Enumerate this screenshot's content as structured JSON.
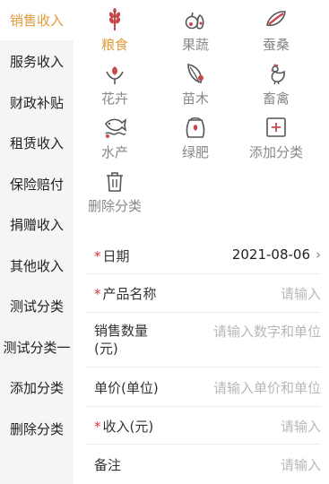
{
  "sidebar": {
    "items": [
      {
        "label": "销售收入",
        "active": true
      },
      {
        "label": "服务收入"
      },
      {
        "label": "财政补贴"
      },
      {
        "label": "租赁收入"
      },
      {
        "label": "保险赔付"
      },
      {
        "label": "捐赠收入"
      },
      {
        "label": "其他收入"
      },
      {
        "label": "测试分类"
      },
      {
        "label": "测试分类一"
      },
      {
        "label": "添加分类"
      },
      {
        "label": "删除分类"
      }
    ]
  },
  "categories": [
    {
      "label": "粮食",
      "icon": "wheat-icon",
      "selected": true
    },
    {
      "label": "果蔬",
      "icon": "fruit-vegetable-icon"
    },
    {
      "label": "蚕桑",
      "icon": "silkworm-icon"
    },
    {
      "label": "花卉",
      "icon": "flower-icon"
    },
    {
      "label": "苗木",
      "icon": "seedling-icon"
    },
    {
      "label": "畜禽",
      "icon": "rooster-icon"
    },
    {
      "label": "水产",
      "icon": "fish-icon"
    },
    {
      "label": "绿肥",
      "icon": "fertilizer-bag-icon"
    },
    {
      "label": "添加分类",
      "icon": "add-box-icon"
    },
    {
      "label": "删除分类",
      "icon": "trash-icon"
    }
  ],
  "form": {
    "date": {
      "label": "日期",
      "value": "2021-08-06"
    },
    "product": {
      "label": "产品名称",
      "placeholder": "请输入"
    },
    "quantity": {
      "label_line1": "销售数量",
      "label_line2": "(元)",
      "placeholder": "请输入数字和单位"
    },
    "unit_price": {
      "label": "单价(单位)",
      "placeholder": "请输入单价和单位"
    },
    "income": {
      "label": "收入(元)",
      "placeholder": "请输入"
    },
    "note": {
      "label": "备注",
      "placeholder": "请输入"
    }
  },
  "colors": {
    "accent": "#e39a3b",
    "required": "#d9343a",
    "icon_red": "#c9464a"
  }
}
